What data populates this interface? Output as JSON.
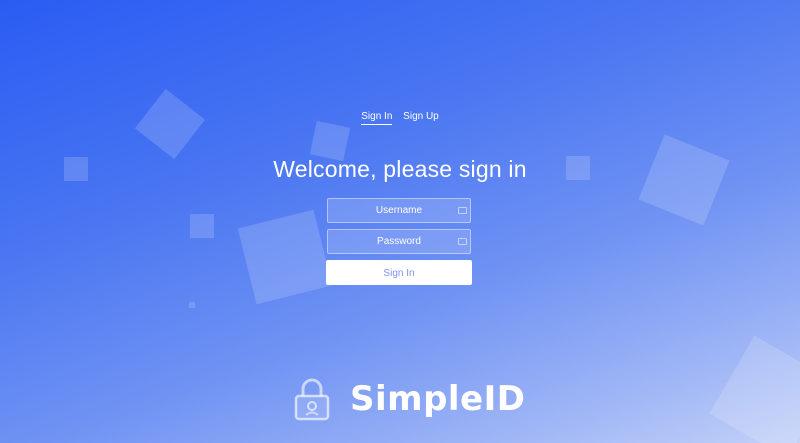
{
  "tabs": [
    {
      "label": "Sign In",
      "active": true
    },
    {
      "label": "Sign Up",
      "active": false
    }
  ],
  "heading": "Welcome, please sign in",
  "form": {
    "username_placeholder": "Username",
    "password_placeholder": "Password",
    "submit_label": "Sign In"
  },
  "brand": {
    "name": "SimpleID",
    "logo_icon": "padlock-icon"
  },
  "colors": {
    "background_start": "#2a5cf3",
    "background_end": "#c3d1f8",
    "button_background": "#ffffff",
    "button_text": "#7b93ee"
  }
}
